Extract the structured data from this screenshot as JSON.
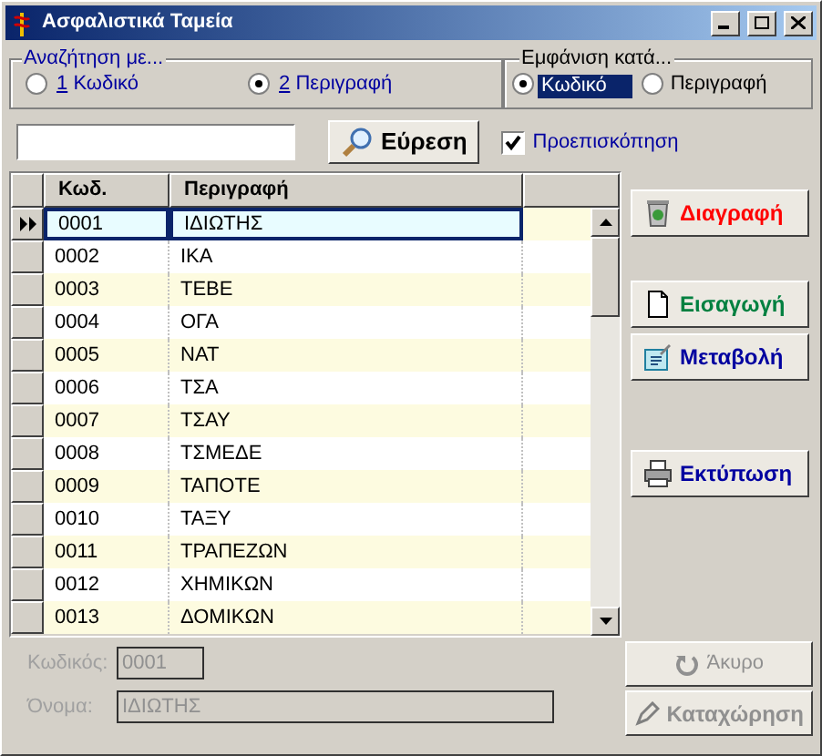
{
  "window": {
    "title": "Ασφαλιστικά Ταμεία"
  },
  "search_by": {
    "title": "Αναζήτηση με...",
    "options": [
      {
        "hotkey": "1",
        "label": "Κωδικό",
        "selected": false
      },
      {
        "hotkey": "2",
        "label": "Περιγραφή",
        "selected": true
      }
    ]
  },
  "display_by": {
    "title": "Εμφάνιση κατά...",
    "options": [
      {
        "label": "Κωδικό",
        "selected": true
      },
      {
        "label": "Περιγραφή",
        "selected": false
      }
    ]
  },
  "find_button": {
    "label": "Εύρεση"
  },
  "preview": {
    "label": "Προεπισκόπηση",
    "checked": true
  },
  "table": {
    "columns": [
      "Κωδ.",
      "Περιγραφή"
    ],
    "rows": [
      {
        "code": "0001",
        "description": "ΙΔΙΩΤΗΣ",
        "selected": true
      },
      {
        "code": "0002",
        "description": "ΙΚΑ",
        "selected": false
      },
      {
        "code": "0003",
        "description": "ΤΕΒΕ",
        "selected": false
      },
      {
        "code": "0004",
        "description": "ΟΓΑ",
        "selected": false
      },
      {
        "code": "0005",
        "description": "ΝΑΤ",
        "selected": false
      },
      {
        "code": "0006",
        "description": "ΤΣΑ",
        "selected": false
      },
      {
        "code": "0007",
        "description": "ΤΣΑΥ",
        "selected": false
      },
      {
        "code": "0008",
        "description": "ΤΣΜΕΔΕ",
        "selected": false
      },
      {
        "code": "0009",
        "description": "ΤΑΠΟΤΕ",
        "selected": false
      },
      {
        "code": "0010",
        "description": "ΤΑΞΥ",
        "selected": false
      },
      {
        "code": "0011",
        "description": "ΤΡΑΠΕΖΩΝ",
        "selected": false
      },
      {
        "code": "0012",
        "description": "ΧΗΜΙΚΩΝ",
        "selected": false
      },
      {
        "code": "0013",
        "description": "ΔΟΜΙΚΩΝ",
        "selected": false
      }
    ]
  },
  "actions": [
    {
      "label": "Διαγραφή",
      "kind": "delete"
    },
    {
      "label": "Εισαγωγή",
      "kind": "insert"
    },
    {
      "label": "Μεταβολή",
      "kind": "edit"
    },
    {
      "label": "Εκτύπωση",
      "kind": "print"
    }
  ],
  "form": {
    "fields": [
      {
        "label": "Κωδικός:",
        "value": "0001",
        "kind": "short",
        "disabled": true
      },
      {
        "label": "Όνομα:",
        "value": "ΙΔΙΩΤΗΣ",
        "kind": "long",
        "disabled": true
      }
    ]
  },
  "bottom_buttons": [
    {
      "label": "Άκυρο",
      "kind": "cancel",
      "disabled": true
    },
    {
      "label": "Καταχώρηση",
      "kind": "save",
      "disabled": true
    }
  ]
}
